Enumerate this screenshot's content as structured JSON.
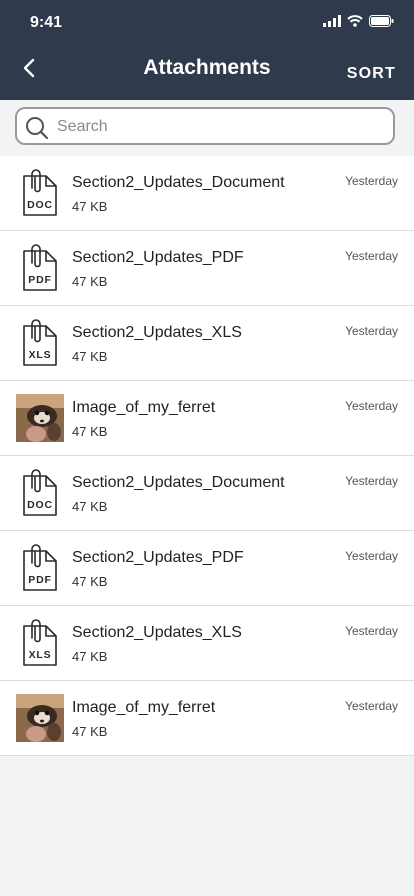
{
  "status_bar": {
    "time": "9:41"
  },
  "header": {
    "title": "Attachments",
    "sort_label": "SORT"
  },
  "search": {
    "placeholder": "Search"
  },
  "attachments": [
    {
      "type": "doc",
      "icon_label": "DOC",
      "name": "Section2_Updates_Document",
      "size": "47 KB",
      "date": "Yesterday"
    },
    {
      "type": "pdf",
      "icon_label": "PDF",
      "name": "Section2_Updates_PDF",
      "size": "47 KB",
      "date": "Yesterday"
    },
    {
      "type": "xls",
      "icon_label": "XLS",
      "name": "Section2_Updates_XLS",
      "size": "47 KB",
      "date": "Yesterday"
    },
    {
      "type": "image",
      "icon_label": "",
      "name": "Image_of_my_ferret",
      "size": "47 KB",
      "date": "Yesterday"
    },
    {
      "type": "doc",
      "icon_label": "DOC",
      "name": "Section2_Updates_Document",
      "size": "47 KB",
      "date": "Yesterday"
    },
    {
      "type": "pdf",
      "icon_label": "PDF",
      "name": "Section2_Updates_PDF",
      "size": "47 KB",
      "date": "Yesterday"
    },
    {
      "type": "xls",
      "icon_label": "XLS",
      "name": "Section2_Updates_XLS",
      "size": "47 KB",
      "date": "Yesterday"
    },
    {
      "type": "image",
      "icon_label": "",
      "name": "Image_of_my_ferret",
      "size": "47 KB",
      "date": "Yesterday"
    }
  ]
}
